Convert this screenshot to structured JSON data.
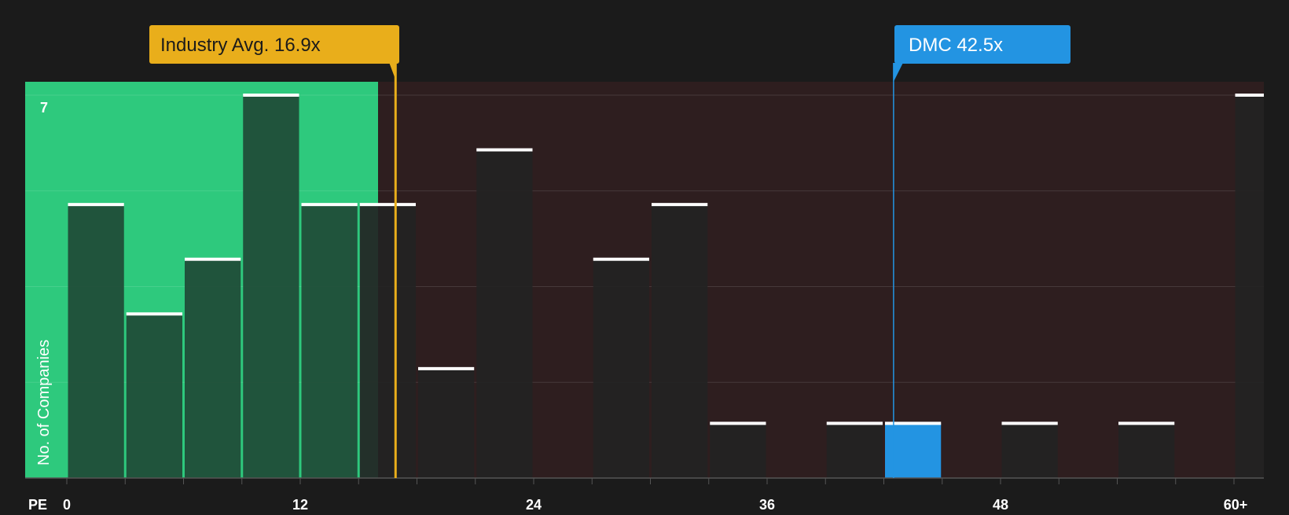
{
  "colors": {
    "background": "#1b1b1b",
    "fair_zone": "#2ec97d",
    "expensive_zone": "#2e1e1f",
    "bar_fill": "#232323",
    "bar_fill_in_fair_zone": "#1f4a36",
    "highlight_bar": "#2394e2",
    "industry_marker": "#e9ae1b",
    "company_marker": "#2394e2",
    "value_line": "#ffffff",
    "axis_text": "#ffffff"
  },
  "chart_data": {
    "type": "bar",
    "title": "",
    "xlabel": "PE",
    "ylabel": "No. of Companies",
    "x_ticks": [
      "0",
      "12",
      "24",
      "36",
      "48",
      "60+"
    ],
    "y_tick_labels": [
      "7"
    ],
    "ylim": [
      0,
      7
    ],
    "bin_width": 3,
    "bins": [
      {
        "start": 0,
        "count": 5
      },
      {
        "start": 3,
        "count": 3
      },
      {
        "start": 6,
        "count": 4
      },
      {
        "start": 9,
        "count": 7
      },
      {
        "start": 12,
        "count": 5
      },
      {
        "start": 15,
        "count": 5
      },
      {
        "start": 18,
        "count": 2
      },
      {
        "start": 21,
        "count": 6
      },
      {
        "start": 24,
        "count": 0
      },
      {
        "start": 27,
        "count": 4
      },
      {
        "start": 30,
        "count": 5
      },
      {
        "start": 33,
        "count": 1
      },
      {
        "start": 36,
        "count": 0
      },
      {
        "start": 39,
        "count": 1
      },
      {
        "start": 42,
        "count": 1,
        "highlight": true
      },
      {
        "start": 45,
        "count": 0
      },
      {
        "start": 48,
        "count": 1
      },
      {
        "start": 51,
        "count": 0
      },
      {
        "start": 54,
        "count": 1
      },
      {
        "start": 57,
        "count": 0
      },
      {
        "start": 60,
        "count": 7
      }
    ],
    "fair_zone_end": 16.0,
    "industry_avg": {
      "label": "Industry Avg. 16.9x",
      "value": 16.9
    },
    "company": {
      "label": "DMC 42.5x",
      "value": 42.5
    },
    "grid": true
  }
}
